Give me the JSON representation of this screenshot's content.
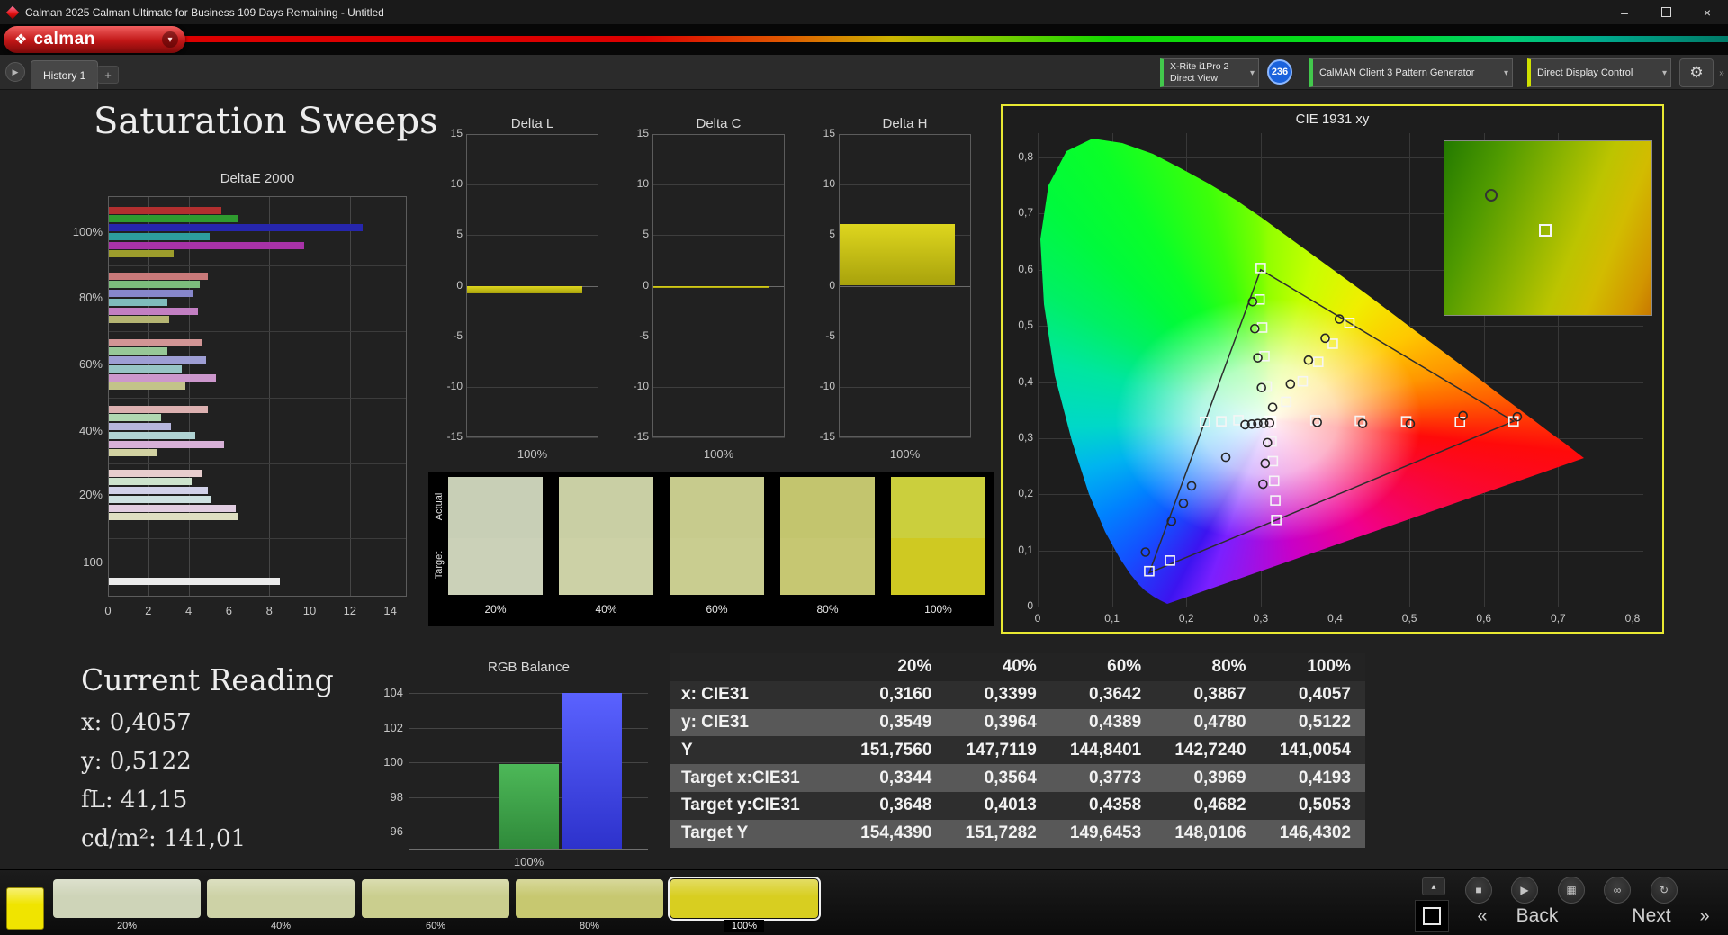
{
  "window": {
    "title": "Calman 2025 Calman Ultimate for Business 109 Days Remaining  - Untitled"
  },
  "brand": {
    "logo_text": "calman"
  },
  "tabs": {
    "active": "History 1",
    "add": "+"
  },
  "icons": {
    "logo_diamond": "❖",
    "dropdown_chevron": "▾",
    "tab_arrow": "▶",
    "gear": "⚙",
    "overflow_arrow": "»",
    "minimize": "–",
    "close": "×",
    "eject": "▴"
  },
  "device_bar": {
    "meter": {
      "line1": "X-Rite i1Pro 2",
      "line2": "Direct View"
    },
    "badge": "236",
    "pattern_generator": "CalMAN Client 3 Pattern Generator",
    "display_control": "Direct Display Control"
  },
  "page": {
    "title": "Saturation Sweeps"
  },
  "current_reading": {
    "title": "Current Reading",
    "lines": [
      "x: 0,4057",
      "y: 0,5122",
      "fL: 41,15",
      "cd/m²: 141,01"
    ]
  },
  "colors": {
    "meter_status": "#42c84c",
    "pattern_status": "#42c84c",
    "display_status": "#cfe000",
    "badge": "#1a62dc",
    "cie_panel_border": "#e8e832",
    "brand_red": "#c01616",
    "selected_patch_outline": "#f0f0f0"
  },
  "swatches": {
    "row_labels": [
      "Actual",
      "Target"
    ],
    "columns": [
      {
        "label": "20%",
        "actual": "#c8cfb6",
        "target": "#cbd1b8"
      },
      {
        "label": "40%",
        "actual": "#c9cfa4",
        "target": "#ccd1a6"
      },
      {
        "label": "60%",
        "actual": "#c7cb8d",
        "target": "#c9cd90"
      },
      {
        "label": "80%",
        "actual": "#c3c56e",
        "target": "#c6c772"
      },
      {
        "label": "100%",
        "actual": "#cbcf3d",
        "target": "#cfc922"
      }
    ]
  },
  "chart_data": [
    {
      "id": "deltae2000",
      "type": "bar",
      "orientation": "horizontal",
      "title": "DeltaE 2000",
      "xlim": [
        0,
        14
      ],
      "xticks": [
        0,
        2,
        4,
        6,
        8,
        10,
        12,
        14
      ],
      "groups": [
        {
          "label": "100%",
          "bars": [
            {
              "color": "#b22f2f",
              "value": 5.6
            },
            {
              "color": "#2f9b2f",
              "value": 6.4
            },
            {
              "color": "#2626ad",
              "value": 12.6
            },
            {
              "color": "#2d9d9d",
              "value": 5.0
            },
            {
              "color": "#a832a8",
              "value": 9.7
            },
            {
              "color": "#9d9d2c",
              "value": 3.2
            }
          ]
        },
        {
          "label": "80%",
          "bars": [
            {
              "color": "#c97a7a",
              "value": 4.9
            },
            {
              "color": "#7dbd7d",
              "value": 4.5
            },
            {
              "color": "#8787cb",
              "value": 4.2
            },
            {
              "color": "#7fbcbc",
              "value": 2.9
            },
            {
              "color": "#c27fc2",
              "value": 4.4
            },
            {
              "color": "#b5b573",
              "value": 3.0
            }
          ]
        },
        {
          "label": "60%",
          "bars": [
            {
              "color": "#d29595",
              "value": 4.6
            },
            {
              "color": "#97c897",
              "value": 2.9
            },
            {
              "color": "#9e9ed4",
              "value": 4.8
            },
            {
              "color": "#97c5c5",
              "value": 3.6
            },
            {
              "color": "#cc97cc",
              "value": 5.3
            },
            {
              "color": "#c3c389",
              "value": 3.8
            }
          ]
        },
        {
          "label": "40%",
          "bars": [
            {
              "color": "#dcb0b0",
              "value": 4.9
            },
            {
              "color": "#b1d7b1",
              "value": 2.6
            },
            {
              "color": "#b6b6dd",
              "value": 3.1
            },
            {
              "color": "#b0d3d3",
              "value": 4.3
            },
            {
              "color": "#d7b0d7",
              "value": 5.7
            },
            {
              "color": "#d2d2a2",
              "value": 2.4
            }
          ]
        },
        {
          "label": "20%",
          "bars": [
            {
              "color": "#e7cdcd",
              "value": 4.6
            },
            {
              "color": "#cde3cd",
              "value": 4.1
            },
            {
              "color": "#d1d1e9",
              "value": 4.9
            },
            {
              "color": "#cde1e1",
              "value": 5.1
            },
            {
              "color": "#e1cde1",
              "value": 6.3
            },
            {
              "color": "#dedec2",
              "value": 6.4
            }
          ]
        },
        {
          "label": "100",
          "bars": [
            {
              "color": "#ebebeb",
              "value": 8.5
            }
          ]
        }
      ]
    },
    {
      "id": "delta_l",
      "type": "bar",
      "title": "Delta L",
      "ylim": [
        -15,
        15
      ],
      "yticks": [
        15,
        10,
        5,
        0,
        -5,
        -10,
        -15
      ],
      "xlabel": "100%",
      "value": -0.8
    },
    {
      "id": "delta_c",
      "type": "bar",
      "title": "Delta C",
      "ylim": [
        -15,
        15
      ],
      "yticks": [
        15,
        10,
        5,
        0,
        -5,
        -10,
        -15
      ],
      "xlabel": "100%",
      "value": -0.2
    },
    {
      "id": "delta_h",
      "type": "bar",
      "title": "Delta H",
      "ylim": [
        -15,
        15
      ],
      "yticks": [
        15,
        10,
        5,
        0,
        -5,
        -10,
        -15
      ],
      "xlabel": "100%",
      "value": 6.1
    },
    {
      "id": "cie1931",
      "type": "scatter",
      "title": "CIE 1931 xy",
      "xlim": [
        0,
        0.8
      ],
      "ylim": [
        0,
        0.8
      ],
      "tick_step": 0.1,
      "white_point": {
        "x": 0.3127,
        "y": 0.329
      },
      "gamut_triangle": [
        {
          "x": 0.64,
          "y": 0.33
        },
        {
          "x": 0.3,
          "y": 0.6
        },
        {
          "x": 0.15,
          "y": 0.06
        }
      ],
      "targets": [
        {
          "x": 0.3344,
          "y": 0.3648
        },
        {
          "x": 0.3564,
          "y": 0.4013
        },
        {
          "x": 0.3773,
          "y": 0.4358
        },
        {
          "x": 0.3969,
          "y": 0.4682
        },
        {
          "x": 0.4193,
          "y": 0.5053
        },
        {
          "x": 0.3736,
          "y": 0.332
        },
        {
          "x": 0.4334,
          "y": 0.331
        },
        {
          "x": 0.4956,
          "y": 0.33
        },
        {
          "x": 0.5679,
          "y": 0.329
        },
        {
          "x": 0.64,
          "y": 0.33
        },
        {
          "x": 0.308,
          "y": 0.392
        },
        {
          "x": 0.305,
          "y": 0.446
        },
        {
          "x": 0.302,
          "y": 0.497
        },
        {
          "x": 0.2985,
          "y": 0.547
        },
        {
          "x": 0.3,
          "y": 0.603
        },
        {
          "x": 0.3146,
          "y": 0.294
        },
        {
          "x": 0.3163,
          "y": 0.259
        },
        {
          "x": 0.318,
          "y": 0.224
        },
        {
          "x": 0.3196,
          "y": 0.189
        },
        {
          "x": 0.3209,
          "y": 0.1542
        },
        {
          "x": 0.27,
          "y": 0.332
        },
        {
          "x": 0.247,
          "y": 0.33
        },
        {
          "x": 0.225,
          "y": 0.329
        },
        {
          "x": 0.178,
          "y": 0.082
        },
        {
          "x": 0.15,
          "y": 0.063
        }
      ],
      "measurements": [
        {
          "x": 0.316,
          "y": 0.3549
        },
        {
          "x": 0.3399,
          "y": 0.3964
        },
        {
          "x": 0.3642,
          "y": 0.4389
        },
        {
          "x": 0.3867,
          "y": 0.478
        },
        {
          "x": 0.4057,
          "y": 0.5122
        },
        {
          "x": 0.376,
          "y": 0.328
        },
        {
          "x": 0.437,
          "y": 0.326
        },
        {
          "x": 0.501,
          "y": 0.3255
        },
        {
          "x": 0.572,
          "y": 0.34
        },
        {
          "x": 0.645,
          "y": 0.338
        },
        {
          "x": 0.301,
          "y": 0.39
        },
        {
          "x": 0.296,
          "y": 0.443
        },
        {
          "x": 0.292,
          "y": 0.495
        },
        {
          "x": 0.289,
          "y": 0.543
        },
        {
          "x": 0.309,
          "y": 0.292
        },
        {
          "x": 0.306,
          "y": 0.255
        },
        {
          "x": 0.303,
          "y": 0.218
        },
        {
          "x": 0.253,
          "y": 0.266
        },
        {
          "x": 0.207,
          "y": 0.215
        },
        {
          "x": 0.196,
          "y": 0.184
        },
        {
          "x": 0.18,
          "y": 0.152
        },
        {
          "x": 0.145,
          "y": 0.097
        },
        {
          "x": 0.288,
          "y": 0.325
        },
        {
          "x": 0.296,
          "y": 0.326
        },
        {
          "x": 0.304,
          "y": 0.3265
        },
        {
          "x": 0.312,
          "y": 0.327
        },
        {
          "x": 0.279,
          "y": 0.324
        }
      ],
      "inset": {
        "circle": {
          "x": 0.22,
          "y": 0.3
        },
        "square": {
          "x": 0.48,
          "y": 0.5
        }
      }
    },
    {
      "id": "rgb_balance",
      "type": "bar",
      "title": "RGB Balance",
      "ylim": [
        95,
        105
      ],
      "yticks": [
        104,
        102,
        100,
        98,
        96
      ],
      "xlabel": "100%",
      "bars": [
        {
          "name": "green",
          "color": "#4db858",
          "color_dark": "#2f8a3a",
          "value": 99.9
        },
        {
          "name": "blue",
          "color": "#5a62ff",
          "color_dark": "#2d32cc",
          "value": 104.0
        }
      ]
    },
    {
      "id": "measurement_table",
      "type": "table",
      "columns": [
        "",
        "20%",
        "40%",
        "60%",
        "80%",
        "100%"
      ],
      "rows": [
        {
          "label": "x: CIE31",
          "values": [
            "0,3160",
            "0,3399",
            "0,3642",
            "0,3867",
            "0,4057"
          ]
        },
        {
          "label": "y: CIE31",
          "values": [
            "0,3549",
            "0,3964",
            "0,4389",
            "0,4780",
            "0,5122"
          ]
        },
        {
          "label": "Y",
          "values": [
            "151,7560",
            "147,7119",
            "144,8401",
            "142,7240",
            "141,0054"
          ]
        },
        {
          "label": "Target x:CIE31",
          "values": [
            "0,3344",
            "0,3564",
            "0,3773",
            "0,3969",
            "0,4193"
          ]
        },
        {
          "label": "Target y:CIE31",
          "values": [
            "0,3648",
            "0,4013",
            "0,4358",
            "0,4682",
            "0,5053"
          ]
        },
        {
          "label": "Target Y",
          "values": [
            "154,4390",
            "151,7282",
            "149,6453",
            "148,0106",
            "146,4302"
          ]
        }
      ]
    }
  ],
  "bottom_bar": {
    "reference_swatch_color": "#f0e400",
    "patches": [
      {
        "label": "20%",
        "color": "#ced4b8",
        "selected": false
      },
      {
        "label": "40%",
        "color": "#cdd2a6",
        "selected": false
      },
      {
        "label": "60%",
        "color": "#cace8e",
        "selected": false
      },
      {
        "label": "80%",
        "color": "#c7c870",
        "selected": false
      },
      {
        "label": "100%",
        "color": "#d8ce20",
        "selected": true
      }
    ],
    "transport": [
      {
        "name": "stop",
        "glyph": "■"
      },
      {
        "name": "play",
        "glyph": "▶"
      },
      {
        "name": "save",
        "glyph": "▦"
      },
      {
        "name": "link",
        "glyph": "∞"
      },
      {
        "name": "refresh",
        "glyph": "↻"
      }
    ],
    "prev_glyph": "«",
    "back_label": "Back",
    "next_label": "Next",
    "next_glyph": "»"
  }
}
